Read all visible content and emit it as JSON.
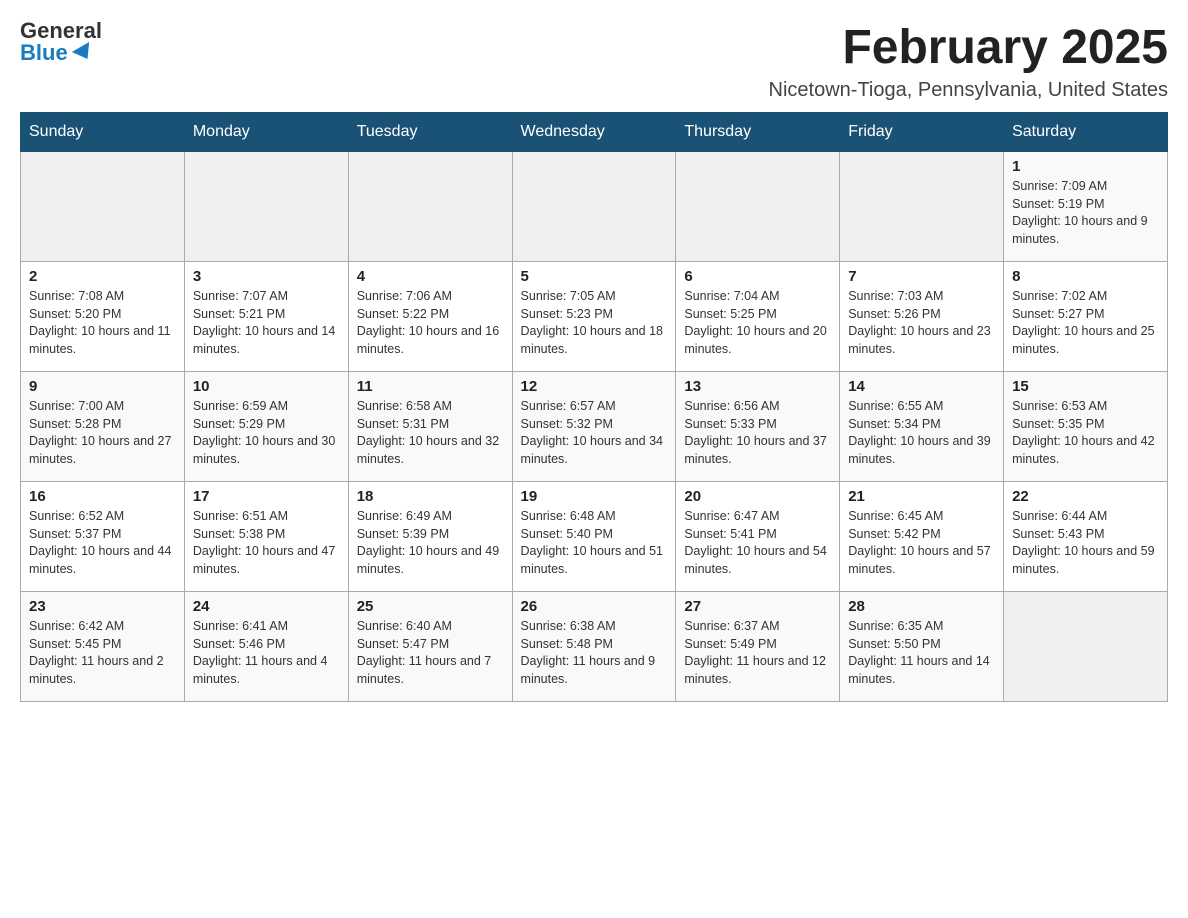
{
  "logo": {
    "general": "General",
    "blue": "Blue"
  },
  "title": "February 2025",
  "subtitle": "Nicetown-Tioga, Pennsylvania, United States",
  "weekdays": [
    "Sunday",
    "Monday",
    "Tuesday",
    "Wednesday",
    "Thursday",
    "Friday",
    "Saturday"
  ],
  "weeks": [
    [
      {
        "day": "",
        "sunrise": "",
        "sunset": "",
        "daylight": ""
      },
      {
        "day": "",
        "sunrise": "",
        "sunset": "",
        "daylight": ""
      },
      {
        "day": "",
        "sunrise": "",
        "sunset": "",
        "daylight": ""
      },
      {
        "day": "",
        "sunrise": "",
        "sunset": "",
        "daylight": ""
      },
      {
        "day": "",
        "sunrise": "",
        "sunset": "",
        "daylight": ""
      },
      {
        "day": "",
        "sunrise": "",
        "sunset": "",
        "daylight": ""
      },
      {
        "day": "1",
        "sunrise": "Sunrise: 7:09 AM",
        "sunset": "Sunset: 5:19 PM",
        "daylight": "Daylight: 10 hours and 9 minutes."
      }
    ],
    [
      {
        "day": "2",
        "sunrise": "Sunrise: 7:08 AM",
        "sunset": "Sunset: 5:20 PM",
        "daylight": "Daylight: 10 hours and 11 minutes."
      },
      {
        "day": "3",
        "sunrise": "Sunrise: 7:07 AM",
        "sunset": "Sunset: 5:21 PM",
        "daylight": "Daylight: 10 hours and 14 minutes."
      },
      {
        "day": "4",
        "sunrise": "Sunrise: 7:06 AM",
        "sunset": "Sunset: 5:22 PM",
        "daylight": "Daylight: 10 hours and 16 minutes."
      },
      {
        "day": "5",
        "sunrise": "Sunrise: 7:05 AM",
        "sunset": "Sunset: 5:23 PM",
        "daylight": "Daylight: 10 hours and 18 minutes."
      },
      {
        "day": "6",
        "sunrise": "Sunrise: 7:04 AM",
        "sunset": "Sunset: 5:25 PM",
        "daylight": "Daylight: 10 hours and 20 minutes."
      },
      {
        "day": "7",
        "sunrise": "Sunrise: 7:03 AM",
        "sunset": "Sunset: 5:26 PM",
        "daylight": "Daylight: 10 hours and 23 minutes."
      },
      {
        "day": "8",
        "sunrise": "Sunrise: 7:02 AM",
        "sunset": "Sunset: 5:27 PM",
        "daylight": "Daylight: 10 hours and 25 minutes."
      }
    ],
    [
      {
        "day": "9",
        "sunrise": "Sunrise: 7:00 AM",
        "sunset": "Sunset: 5:28 PM",
        "daylight": "Daylight: 10 hours and 27 minutes."
      },
      {
        "day": "10",
        "sunrise": "Sunrise: 6:59 AM",
        "sunset": "Sunset: 5:29 PM",
        "daylight": "Daylight: 10 hours and 30 minutes."
      },
      {
        "day": "11",
        "sunrise": "Sunrise: 6:58 AM",
        "sunset": "Sunset: 5:31 PM",
        "daylight": "Daylight: 10 hours and 32 minutes."
      },
      {
        "day": "12",
        "sunrise": "Sunrise: 6:57 AM",
        "sunset": "Sunset: 5:32 PM",
        "daylight": "Daylight: 10 hours and 34 minutes."
      },
      {
        "day": "13",
        "sunrise": "Sunrise: 6:56 AM",
        "sunset": "Sunset: 5:33 PM",
        "daylight": "Daylight: 10 hours and 37 minutes."
      },
      {
        "day": "14",
        "sunrise": "Sunrise: 6:55 AM",
        "sunset": "Sunset: 5:34 PM",
        "daylight": "Daylight: 10 hours and 39 minutes."
      },
      {
        "day": "15",
        "sunrise": "Sunrise: 6:53 AM",
        "sunset": "Sunset: 5:35 PM",
        "daylight": "Daylight: 10 hours and 42 minutes."
      }
    ],
    [
      {
        "day": "16",
        "sunrise": "Sunrise: 6:52 AM",
        "sunset": "Sunset: 5:37 PM",
        "daylight": "Daylight: 10 hours and 44 minutes."
      },
      {
        "day": "17",
        "sunrise": "Sunrise: 6:51 AM",
        "sunset": "Sunset: 5:38 PM",
        "daylight": "Daylight: 10 hours and 47 minutes."
      },
      {
        "day": "18",
        "sunrise": "Sunrise: 6:49 AM",
        "sunset": "Sunset: 5:39 PM",
        "daylight": "Daylight: 10 hours and 49 minutes."
      },
      {
        "day": "19",
        "sunrise": "Sunrise: 6:48 AM",
        "sunset": "Sunset: 5:40 PM",
        "daylight": "Daylight: 10 hours and 51 minutes."
      },
      {
        "day": "20",
        "sunrise": "Sunrise: 6:47 AM",
        "sunset": "Sunset: 5:41 PM",
        "daylight": "Daylight: 10 hours and 54 minutes."
      },
      {
        "day": "21",
        "sunrise": "Sunrise: 6:45 AM",
        "sunset": "Sunset: 5:42 PM",
        "daylight": "Daylight: 10 hours and 57 minutes."
      },
      {
        "day": "22",
        "sunrise": "Sunrise: 6:44 AM",
        "sunset": "Sunset: 5:43 PM",
        "daylight": "Daylight: 10 hours and 59 minutes."
      }
    ],
    [
      {
        "day": "23",
        "sunrise": "Sunrise: 6:42 AM",
        "sunset": "Sunset: 5:45 PM",
        "daylight": "Daylight: 11 hours and 2 minutes."
      },
      {
        "day": "24",
        "sunrise": "Sunrise: 6:41 AM",
        "sunset": "Sunset: 5:46 PM",
        "daylight": "Daylight: 11 hours and 4 minutes."
      },
      {
        "day": "25",
        "sunrise": "Sunrise: 6:40 AM",
        "sunset": "Sunset: 5:47 PM",
        "daylight": "Daylight: 11 hours and 7 minutes."
      },
      {
        "day": "26",
        "sunrise": "Sunrise: 6:38 AM",
        "sunset": "Sunset: 5:48 PM",
        "daylight": "Daylight: 11 hours and 9 minutes."
      },
      {
        "day": "27",
        "sunrise": "Sunrise: 6:37 AM",
        "sunset": "Sunset: 5:49 PM",
        "daylight": "Daylight: 11 hours and 12 minutes."
      },
      {
        "day": "28",
        "sunrise": "Sunrise: 6:35 AM",
        "sunset": "Sunset: 5:50 PM",
        "daylight": "Daylight: 11 hours and 14 minutes."
      },
      {
        "day": "",
        "sunrise": "",
        "sunset": "",
        "daylight": ""
      }
    ]
  ]
}
